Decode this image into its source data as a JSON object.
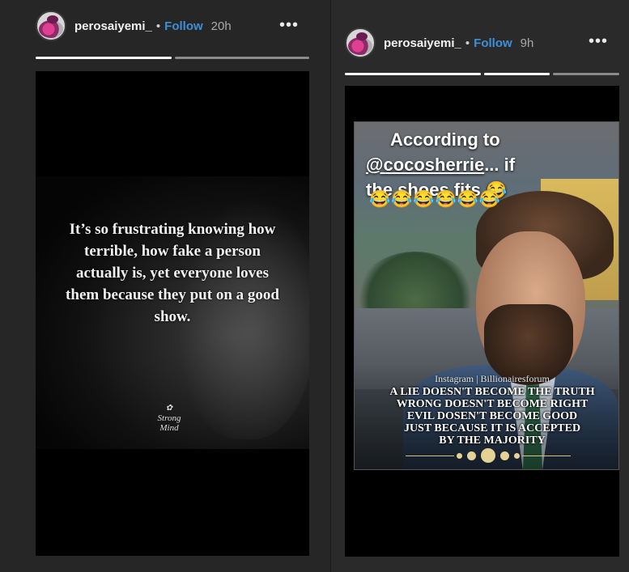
{
  "stories": [
    {
      "username": "perosaiyemi_",
      "separator": "•",
      "follow_label": "Follow",
      "time": "20h",
      "more_label": "•••",
      "progress": [
        1.0,
        0.0
      ],
      "quote": "It’s so frustrating knowing how terrible, how fake a person actually is, yet everyone loves them because they put on a good show.",
      "signature": "Strong Mind"
    },
    {
      "username": "perosaiyemi_",
      "separator": "•",
      "follow_label": "Follow",
      "time": "9h",
      "more_label": "•••",
      "progress": [
        1.0,
        1.0,
        0.0
      ],
      "caption_line1": "According to",
      "caption_mention": "@cocosherrie",
      "caption_after_mention": "... if",
      "caption_line3": "the shoes fits",
      "caption_emoji": "😂",
      "emoji_row": "😂😂😂😂😂😂",
      "quote_source": "Instagram | Billionairesforum",
      "quote_lines": [
        "A LIE DOESN'T BECOME THE TRUTH",
        "WRONG DOESN'T  BECOME RIGHT",
        "EVIL DOSEN'T BECOME GOOD",
        "JUST BECAUSE IT IS ACCEPTED",
        "BY THE MAJORITY"
      ]
    }
  ],
  "colors": {
    "background": "#2b2b2b",
    "follow": "#3f8fd6",
    "viewer": "#000000"
  }
}
